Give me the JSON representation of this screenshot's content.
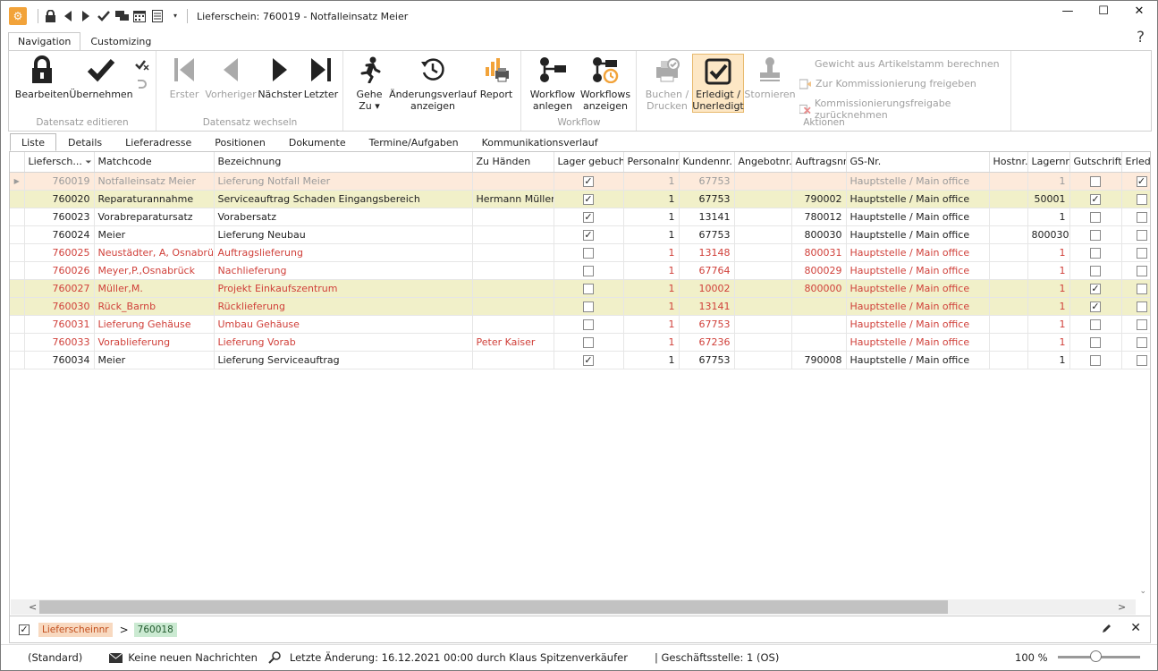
{
  "window": {
    "title": "Lieferschein: 760019 - Notfalleinsatz Meier"
  },
  "ribbon_tabs": [
    {
      "label": "Navigation"
    },
    {
      "label": "Customizing"
    }
  ],
  "ribbon": {
    "groups": {
      "edit": {
        "label": "Datensatz editieren",
        "bearbeiten": "Bearbeiten",
        "uebernehmen": "Übernehmen"
      },
      "nav": {
        "label": "Datensatz wechseln",
        "erster": "Erster",
        "vorheriger": "Vorheriger",
        "naechster": "Nächster",
        "letzter": "Letzter"
      },
      "misc": {
        "gehe_zu_1": "Gehe",
        "gehe_zu_2": "Zu",
        "aend_1": "Änderungsverlauf",
        "aend_2": "anzeigen",
        "report": "Report"
      },
      "workflow": {
        "label": "Workflow",
        "wf_anlegen_1": "Workflow",
        "wf_anlegen_2": "anlegen",
        "wfs_anz_1": "Workflows",
        "wfs_anz_2": "anzeigen"
      },
      "aktionen": {
        "label": "Aktionen",
        "buchen_1": "Buchen /",
        "buchen_2": "Drucken",
        "erledigt_1": "Erledigt /",
        "erledigt_2": "Unerledigt",
        "stornieren": "Stornieren",
        "gewicht": "Gewicht aus Artikelstamm berechnen",
        "kommission_frei": "Zur Kommissionierung freigeben",
        "kommission_zurueck": "Kommissionierungsfreigabe zurücknehmen"
      }
    }
  },
  "view_tabs": [
    {
      "label": "Liste"
    },
    {
      "label": "Details"
    },
    {
      "label": "Lieferadresse"
    },
    {
      "label": "Positionen"
    },
    {
      "label": "Dokumente"
    },
    {
      "label": "Termine/Aufgaben"
    },
    {
      "label": "Kommunikationsverlauf"
    }
  ],
  "columns": [
    "Liefersch...",
    "Matchcode",
    "Bezeichnung",
    "Zu Händen",
    "Lager gebucht",
    "Personalnr.",
    "Kundennr.",
    "Angebotnr.",
    "Auftragsnr.",
    "GS-Nr.",
    "Hostnr.",
    "Lagernr.",
    "Gutschrift",
    "Erledigt"
  ],
  "rows": [
    {
      "style": "sel",
      "nr": "760019",
      "matchcode": "Notfalleinsatz Meier",
      "bez": "Lieferung Notfall Meier",
      "zuhaenden": "",
      "lager": true,
      "personal": "1",
      "kunde": "67753",
      "angebot": "",
      "auftrag": "",
      "gs": "Hauptstelle / Main office",
      "host": "",
      "lagernr": "1",
      "gutschrift": false,
      "erledigt": true
    },
    {
      "style": "yel",
      "nr": "760020",
      "matchcode": "Reparaturannahme",
      "bez": "Serviceauftrag Schaden Eingangsbereich",
      "zuhaenden": "Hermann Müller",
      "lager": true,
      "personal": "1",
      "kunde": "67753",
      "angebot": "",
      "auftrag": "790002",
      "gs": "Hauptstelle / Main office",
      "host": "",
      "lagernr": "50001",
      "gutschrift": true,
      "erledigt": false
    },
    {
      "style": "",
      "nr": "760023",
      "matchcode": "Vorabreparatursatz",
      "bez": "Vorabersatz",
      "zuhaenden": "",
      "lager": true,
      "personal": "1",
      "kunde": "13141",
      "angebot": "",
      "auftrag": "780012",
      "gs": "Hauptstelle / Main office",
      "host": "",
      "lagernr": "1",
      "gutschrift": false,
      "erledigt": false
    },
    {
      "style": "",
      "nr": "760024",
      "matchcode": "Meier",
      "bez": "Lieferung Neubau",
      "zuhaenden": "",
      "lager": true,
      "personal": "1",
      "kunde": "67753",
      "angebot": "",
      "auftrag": "800030",
      "gs": "Hauptstelle / Main office",
      "host": "",
      "lagernr": "800030",
      "gutschrift": false,
      "erledigt": false
    },
    {
      "style": "red",
      "nr": "760025",
      "matchcode": "Neustädter, A, Osnabrück",
      "bez": "Auftragslieferung",
      "zuhaenden": "",
      "lager": false,
      "personal": "1",
      "kunde": "13148",
      "angebot": "",
      "auftrag": "800031",
      "gs": "Hauptstelle / Main office",
      "host": "",
      "lagernr": "1",
      "gutschrift": false,
      "erledigt": false
    },
    {
      "style": "red",
      "nr": "760026",
      "matchcode": "Meyer,P.,Osnabrück",
      "bez": "Nachlieferung",
      "zuhaenden": "",
      "lager": false,
      "personal": "1",
      "kunde": "67764",
      "angebot": "",
      "auftrag": "800029",
      "gs": "Hauptstelle / Main office",
      "host": "",
      "lagernr": "1",
      "gutschrift": false,
      "erledigt": false
    },
    {
      "style": "yel red",
      "nr": "760027",
      "matchcode": "Müller,M.",
      "bez": "Projekt Einkaufszentrum",
      "zuhaenden": "",
      "lager": false,
      "personal": "1",
      "kunde": "10002",
      "angebot": "",
      "auftrag": "800000",
      "gs": "Hauptstelle / Main office",
      "host": "",
      "lagernr": "1",
      "gutschrift": true,
      "erledigt": false
    },
    {
      "style": "yel red",
      "nr": "760030",
      "matchcode": "Rück_Barnb",
      "bez": "Rücklieferung",
      "zuhaenden": "",
      "lager": false,
      "personal": "1",
      "kunde": "13141",
      "angebot": "",
      "auftrag": "",
      "gs": "Hauptstelle / Main office",
      "host": "",
      "lagernr": "1",
      "gutschrift": true,
      "erledigt": false
    },
    {
      "style": "red",
      "nr": "760031",
      "matchcode": "Lieferung Gehäuse",
      "bez": "Umbau Gehäuse",
      "zuhaenden": "",
      "lager": false,
      "personal": "1",
      "kunde": "67753",
      "angebot": "",
      "auftrag": "",
      "gs": "Hauptstelle / Main office",
      "host": "",
      "lagernr": "1",
      "gutschrift": false,
      "erledigt": false
    },
    {
      "style": "red",
      "nr": "760033",
      "matchcode": "Vorablieferung",
      "bez": "Lieferung Vorab",
      "zuhaenden": "Peter Kaiser",
      "lager": false,
      "personal": "1",
      "kunde": "67236",
      "angebot": "",
      "auftrag": "",
      "gs": "Hauptstelle / Main office",
      "host": "",
      "lagernr": "1",
      "gutschrift": false,
      "erledigt": false
    },
    {
      "style": "",
      "nr": "760034",
      "matchcode": "Meier",
      "bez": "Lieferung Serviceauftrag",
      "zuhaenden": "",
      "lager": true,
      "personal": "1",
      "kunde": "67753",
      "angebot": "",
      "auftrag": "790008",
      "gs": "Hauptstelle / Main office",
      "host": "",
      "lagernr": "1",
      "gutschrift": false,
      "erledigt": false
    }
  ],
  "filter": {
    "field": "Lieferscheinnr",
    "operator": ">",
    "value": "760018"
  },
  "status": {
    "layout": "(Standard)",
    "messages": "Keine neuen Nachrichten",
    "last_change": "Letzte Änderung: 16.12.2021 00:00 durch Klaus Spitzenverkäufer",
    "branch": "| Geschäftsstelle:  1 (OS)",
    "zoom": "100 %"
  },
  "icons": [
    "app-logo-icon",
    "lock-icon",
    "back-arrow-icon",
    "forward-arrow-icon",
    "check-icon",
    "chat-icon",
    "calendar-icon",
    "list-icon",
    "dropdown-icon",
    "minimize-icon",
    "maximize-icon",
    "close-icon",
    "help-icon",
    "filter-icon",
    "pencil-icon",
    "mail-icon",
    "search-icon"
  ],
  "colors": {
    "accent": "#f2a33a",
    "selected_row": "#fdeadb",
    "yellow_row": "#f1f0c9",
    "red_text": "#d0403a"
  }
}
